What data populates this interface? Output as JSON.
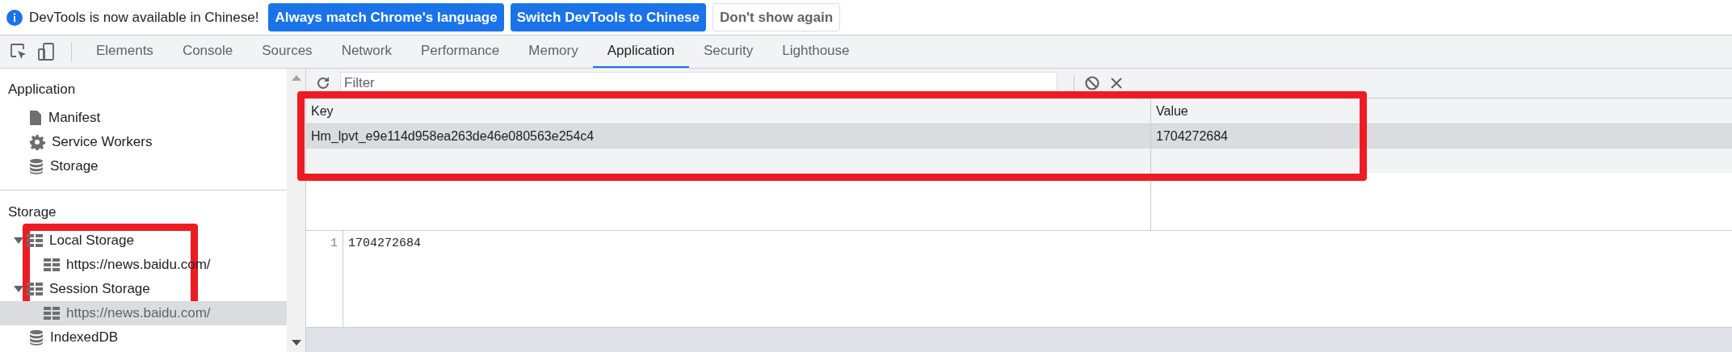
{
  "infobar": {
    "message": "DevTools is now available in Chinese!",
    "buttons": [
      {
        "label": "Always match Chrome's language",
        "kind": "primary"
      },
      {
        "label": "Switch DevTools to Chinese",
        "kind": "primary"
      },
      {
        "label": "Don't show again",
        "kind": "secondary"
      }
    ]
  },
  "tabs": [
    {
      "label": "Elements",
      "selected": false
    },
    {
      "label": "Console",
      "selected": false
    },
    {
      "label": "Sources",
      "selected": false
    },
    {
      "label": "Network",
      "selected": false
    },
    {
      "label": "Performance",
      "selected": false
    },
    {
      "label": "Memory",
      "selected": false
    },
    {
      "label": "Application",
      "selected": true
    },
    {
      "label": "Security",
      "selected": false
    },
    {
      "label": "Lighthouse",
      "selected": false
    }
  ],
  "sidebar": {
    "sections": [
      {
        "title": "Application",
        "items": [
          {
            "label": "Manifest",
            "kind": "file",
            "selected": false
          },
          {
            "label": "Service Workers",
            "kind": "gear",
            "selected": false
          },
          {
            "label": "Storage",
            "kind": "database",
            "selected": false
          }
        ]
      },
      {
        "title": "Storage",
        "items": [
          {
            "label": "Local Storage",
            "kind": "table",
            "selected": false,
            "expanded": true,
            "children": [
              {
                "label": "https://news.baidu.com/",
                "kind": "table",
                "selected": false
              }
            ]
          },
          {
            "label": "Session Storage",
            "kind": "table",
            "selected": false,
            "expanded": true,
            "children": [
              {
                "label": "https://news.baidu.com/",
                "kind": "table",
                "selected": true
              }
            ]
          },
          {
            "label": "IndexedDB",
            "kind": "database",
            "selected": false
          }
        ]
      }
    ]
  },
  "toolbar": {
    "filter_placeholder": "Filter"
  },
  "table": {
    "columns": [
      "Key",
      "Value"
    ],
    "rows": [
      {
        "cells": [
          "Hm_lpvt_e9e114d958ea263de46e080563e254c4",
          "1704272684"
        ],
        "selected": true
      }
    ]
  },
  "preview": {
    "lines": [
      {
        "number": "1",
        "text": "1704272684"
      }
    ]
  }
}
